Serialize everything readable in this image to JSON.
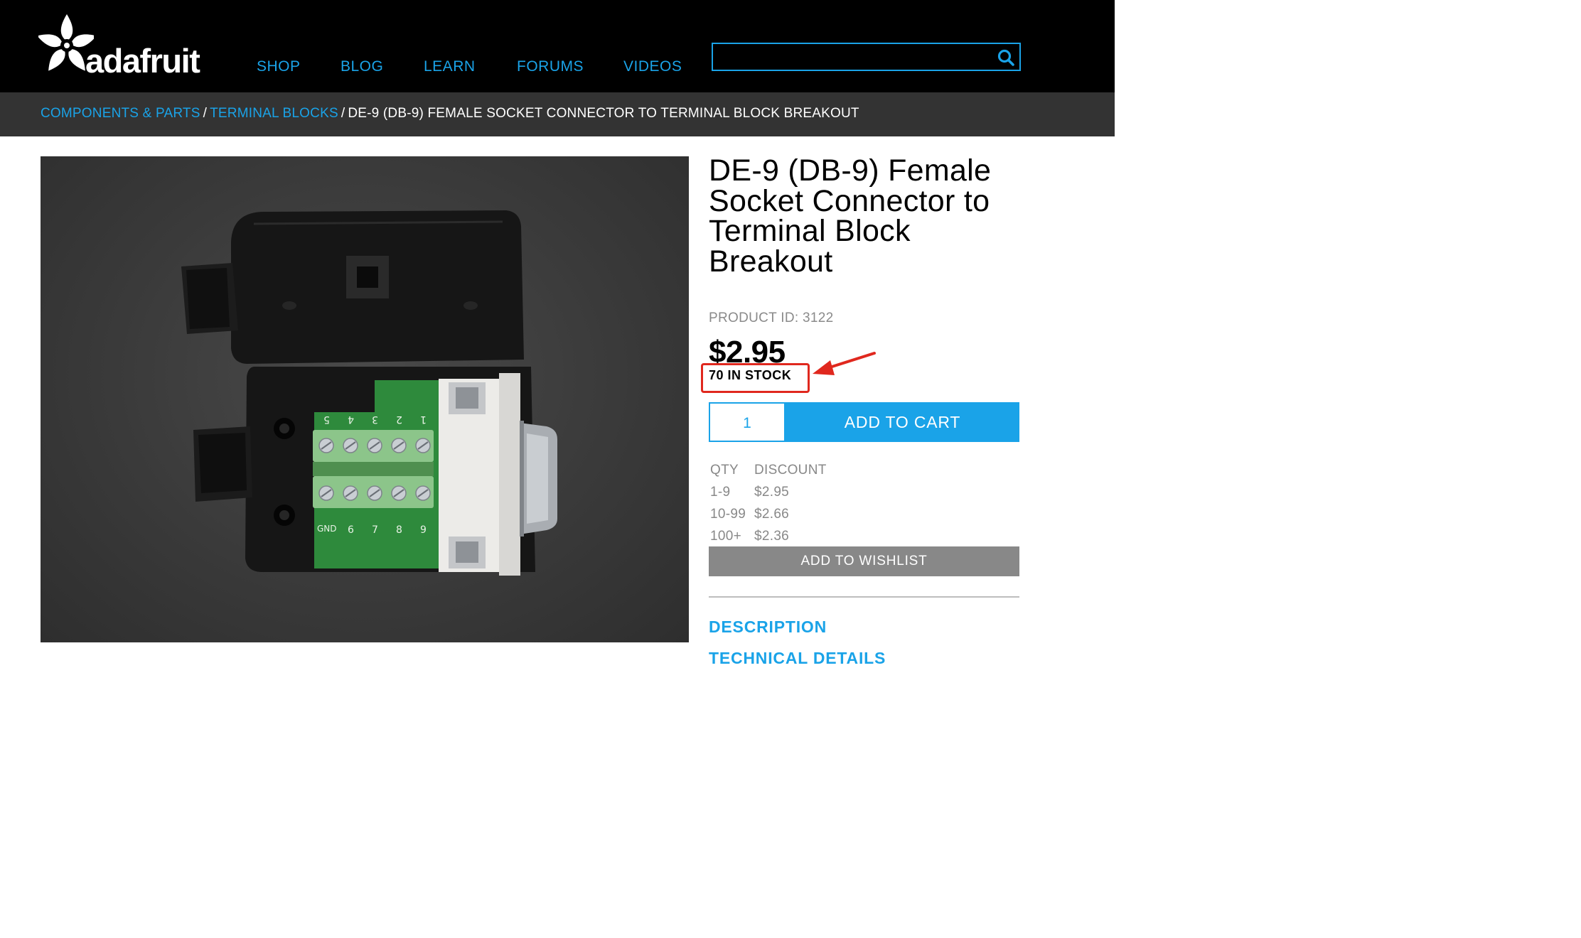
{
  "header": {
    "logo_text": "adafruit",
    "nav": [
      "SHOP",
      "BLOG",
      "LEARN",
      "FORUMS",
      "VIDEOS"
    ],
    "search": {
      "value": "",
      "placeholder": "",
      "icon": "search-icon"
    }
  },
  "breadcrumb": {
    "items": [
      "COMPONENTS & PARTS",
      "TERMINAL BLOCKS"
    ],
    "separator": "/",
    "current": "DE-9 (DB-9) FEMALE SOCKET CONNECTOR TO TERMINAL BLOCK BREAKOUT"
  },
  "product": {
    "title": "DE-9 (DB-9) Female Socket Connector to Terminal Block Breakout",
    "product_id": "PRODUCT ID: 3122",
    "price": "$2.95",
    "stock": "70 IN STOCK",
    "quantity": "1",
    "add_to_cart": "ADD TO CART",
    "add_to_wishlist": "ADD TO WISHLIST",
    "image_pcb_labels": {
      "top": [
        "5",
        "4",
        "3",
        "2",
        "1"
      ],
      "bottom": [
        "GND",
        "6",
        "7",
        "8",
        "9"
      ]
    }
  },
  "discount_table": {
    "headers": [
      "QTY",
      "DISCOUNT"
    ],
    "rows": [
      [
        "1-9",
        "$2.95"
      ],
      [
        "10-99",
        "$2.66"
      ],
      [
        "100+",
        "$2.36"
      ]
    ]
  },
  "sections": [
    "DESCRIPTION",
    "TECHNICAL DETAILS"
  ],
  "colors": {
    "accent": "#1aa3e8",
    "header_bg": "#000000",
    "crumb_bg": "#333333",
    "highlight": "#e0281e",
    "wishlist_bg": "#888888"
  }
}
